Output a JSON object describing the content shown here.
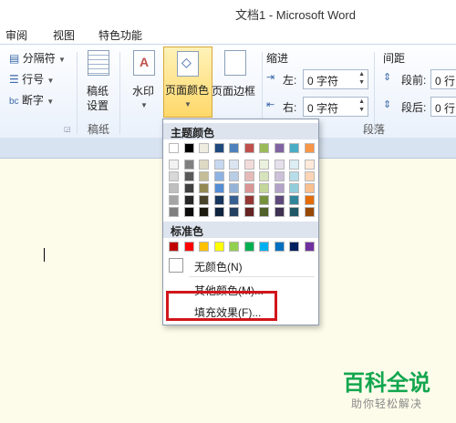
{
  "window": {
    "title": "文档1 - Microsoft Word"
  },
  "tabs": [
    "审阅",
    "视图",
    "特色功能"
  ],
  "ribbon": {
    "left_items": {
      "column": "分隔符",
      "line_numbers": "行号",
      "hyphenation": "断字"
    },
    "manuscript": {
      "label": "稿纸\n设置",
      "label_line1": "稿纸",
      "label_line2": "设置",
      "group": "稿纸"
    },
    "watermark": {
      "label": "水印"
    },
    "page_color": {
      "label": "页面颜色"
    },
    "page_border": {
      "label": "页面边框"
    },
    "indent": {
      "header": "缩进",
      "left_label": "左:",
      "left_value": "0 字符",
      "right_label": "右:",
      "right_value": "0 字符"
    },
    "spacing": {
      "header": "间距",
      "before_label": "段前:",
      "before_value": "0 行",
      "after_label": "段后:",
      "after_value": "0 行"
    },
    "paragraph_group": "段落"
  },
  "color_menu": {
    "theme_header": "主题颜色",
    "theme_top": [
      "#ffffff",
      "#000000",
      "#eeece1",
      "#1f497d",
      "#4f81bd",
      "#c0504d",
      "#9bbb59",
      "#8064a2",
      "#4bacc6",
      "#f79646"
    ],
    "theme_shades": [
      [
        "#f2f2f2",
        "#7f7f7f",
        "#ddd9c3",
        "#c6d9f0",
        "#dbe5f1",
        "#f2dcdb",
        "#ebf1dd",
        "#e5e0ec",
        "#dbeef3",
        "#fdeada"
      ],
      [
        "#d8d8d8",
        "#595959",
        "#c4bd97",
        "#8db3e2",
        "#b8cce4",
        "#e5b9b7",
        "#d7e3bc",
        "#ccc1d9",
        "#b7dde8",
        "#fbd5b5"
      ],
      [
        "#bfbfbf",
        "#3f3f3f",
        "#938953",
        "#548dd4",
        "#95b3d7",
        "#d99694",
        "#c3d69b",
        "#b2a2c7",
        "#92cddc",
        "#fac08f"
      ],
      [
        "#a5a5a5",
        "#262626",
        "#494429",
        "#17365d",
        "#366092",
        "#953734",
        "#76923c",
        "#5f497a",
        "#31859b",
        "#e36c09"
      ],
      [
        "#7f7f7f",
        "#0c0c0c",
        "#1d1b10",
        "#0f243e",
        "#244061",
        "#632423",
        "#4f6128",
        "#3f3151",
        "#205867",
        "#974806"
      ]
    ],
    "standard_header": "标准色",
    "standard": [
      "#c00000",
      "#ff0000",
      "#ffc000",
      "#ffff00",
      "#92d050",
      "#00b050",
      "#00b0f0",
      "#0070c0",
      "#002060",
      "#7030a0"
    ],
    "no_color": "无颜色(N)",
    "more_colors": "其他颜色(M)...",
    "fill_effects": "填充效果(F)..."
  },
  "watermark_brand": {
    "title": "百科全说",
    "subtitle": "助你轻松解决"
  },
  "colors": {
    "highlight": "#d1161b",
    "brand_green": "#13a64f"
  }
}
